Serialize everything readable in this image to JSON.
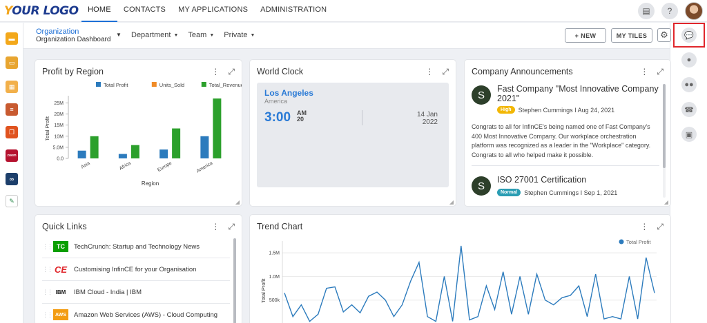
{
  "topnav": {
    "logo": {
      "y": "Y",
      "rest": "OUR LOGO"
    },
    "items": [
      "HOME",
      "CONTACTS",
      "MY APPLICATIONS",
      "ADMINISTRATION"
    ]
  },
  "subbar": {
    "breadcrumb": {
      "title": "Organization",
      "subtitle": "Organization Dashboard"
    },
    "filters": [
      "Department",
      "Team",
      "Private"
    ],
    "new_label": "+ NEW",
    "mytiles_label": "MY TILES"
  },
  "profit_card": {
    "title": "Profit by Region"
  },
  "chart_data": [
    {
      "type": "bar",
      "title": "",
      "xlabel": "Region",
      "ylabel": "Total Profit",
      "categories": [
        "Asia",
        "Africa",
        "Europe",
        "America"
      ],
      "series": [
        {
          "name": "Total Profit",
          "color": "#2c7bbd",
          "values": [
            3500000,
            2000000,
            4000000,
            10000000
          ]
        },
        {
          "name": "Units_Sold",
          "color": "#f08c28",
          "values": [
            0,
            0,
            0,
            0
          ]
        },
        {
          "name": "Total_Revenue",
          "color": "#2ca02c",
          "values": [
            10000000,
            6000000,
            13500000,
            27000000
          ]
        }
      ],
      "yticks": [
        "0.0",
        "5.0M",
        "10M",
        "15M",
        "20M",
        "25M"
      ],
      "ylim": [
        0,
        27000000
      ],
      "legend": "top"
    },
    {
      "type": "line",
      "title": "",
      "ylabel": "Total Profit",
      "series": [
        {
          "name": "Total Profit",
          "color": "#2c7bbd",
          "values": [
            650000,
            150000,
            400000,
            50000,
            200000,
            750000,
            780000,
            250000,
            400000,
            230000,
            580000,
            670000,
            500000,
            150000,
            400000,
            900000,
            1300000,
            150000,
            50000,
            1000000,
            50000,
            1650000,
            80000,
            150000,
            800000,
            300000,
            1100000,
            200000,
            1000000,
            200000,
            1050000,
            500000,
            400000,
            550000,
            600000,
            800000,
            150000,
            1050000,
            100000,
            150000,
            100000,
            1000000,
            100000,
            1400000,
            650000
          ]
        }
      ],
      "yticks": [
        "500k",
        "1.0M",
        "1.5M"
      ],
      "ylim": [
        0,
        1750000
      ],
      "legend": "top-right"
    }
  ],
  "world_clock": {
    "title": "World Clock",
    "city": "Los Angeles",
    "region": "America",
    "time": "3:00",
    "ampm": "AM",
    "seconds": "20",
    "date_day": "14 Jan",
    "date_year": "2022"
  },
  "announcements": {
    "title": "Company Announcements",
    "items": [
      {
        "initial": "S",
        "title": "Fast Company \"Most Innovative Company 2021\"",
        "badge": "High",
        "badge_color": "#f2b705",
        "meta": "Stephen Cummings I Aug 24, 2021",
        "body": "Congrats to all for InfinCE's being named one of Fast Company's 400 Most Innovative Company. Our workplace orchestration platform was recognized as a leader in the \"Workplace\" category. Congrats to all who helped make it possible."
      },
      {
        "initial": "S",
        "title": "ISO 27001 Certification",
        "badge": "Normal",
        "badge_color": "#2a9db3",
        "meta": "Stephen Cummings I Sep 1, 2021",
        "body": ""
      }
    ]
  },
  "quick_links": {
    "title": "Quick Links",
    "items": [
      {
        "icon_text": "TC",
        "label": "TechCrunch: Startup and Technology News"
      },
      {
        "icon_text": "CE",
        "label": "Customising InfinCE for your Organisation"
      },
      {
        "icon_text": "IBM",
        "label": "IBM Cloud - India | IBM"
      },
      {
        "icon_text": "AWS",
        "label": "Amazon Web Services (AWS) - Cloud Computing"
      }
    ]
  },
  "trend_card": {
    "title": "Trend Chart"
  }
}
